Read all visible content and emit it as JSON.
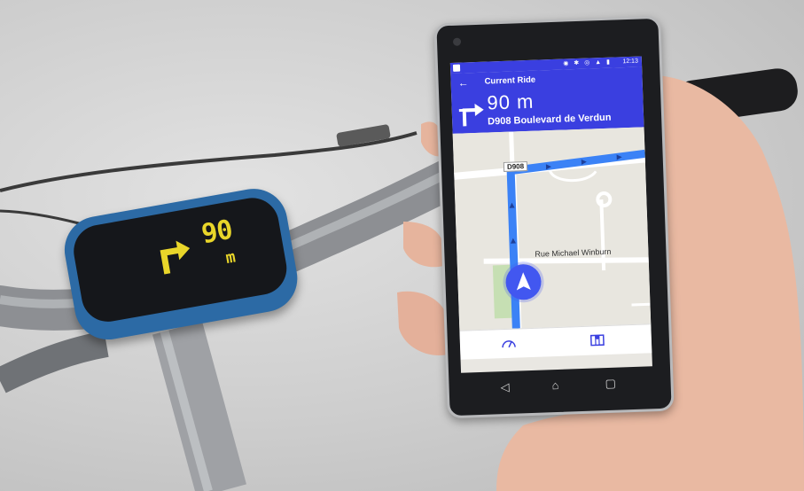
{
  "status_bar": {
    "time": "12:13",
    "icons": "◉ ✱ ◎ ▲ ▮"
  },
  "nav": {
    "back_icon": "back-arrow-icon",
    "title": "Current Ride",
    "distance": "90 m",
    "street": "D908 Boulevard de Verdun",
    "turn_icon": "turn-right-arrow-icon"
  },
  "map": {
    "road_label": "D908",
    "street_label": "Rue Michael Winburn",
    "route_color": "#3b82f6",
    "accent": "#3a3fe0"
  },
  "bottom_bar": {
    "left_icon": "speedometer-icon",
    "right_icon": "map-icon"
  },
  "android_nav": {
    "back": "◁",
    "home": "⌂",
    "recents": "▢"
  },
  "bike_device": {
    "distance_value": "90",
    "distance_unit": "m",
    "arrow_icon": "turn-right-arrow-icon",
    "display_color": "#e9d62a"
  }
}
